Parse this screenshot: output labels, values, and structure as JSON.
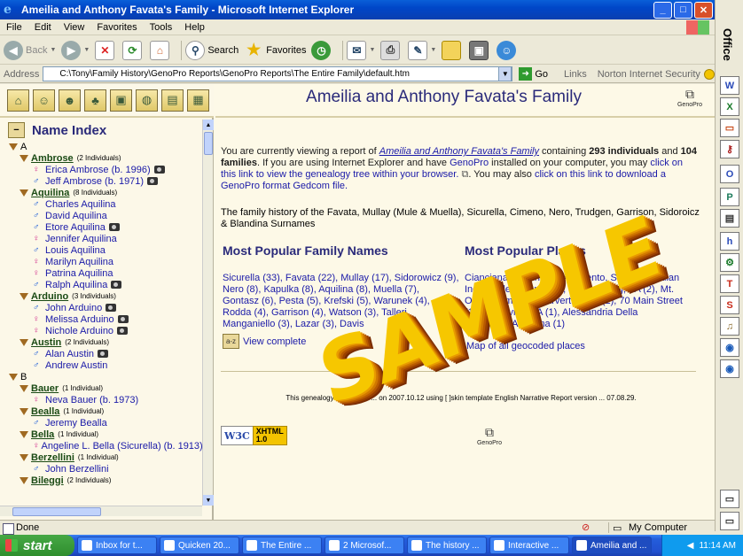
{
  "window": {
    "title": "Ameilia and Anthony Favata's Family - Microsoft Internet Explorer"
  },
  "menu": [
    "File",
    "Edit",
    "View",
    "Favorites",
    "Tools",
    "Help"
  ],
  "toolbar": {
    "back_label": "Back",
    "search_label": "Search",
    "favorites_label": "Favorites"
  },
  "address": {
    "label": "Address",
    "value": "C:\\Tony\\Family History\\GenoPro Reports\\GenoPro Reports\\The Entire Family\\default.htm",
    "go_label": "Go",
    "links_label": "Links",
    "norton_label": "Norton Internet Security"
  },
  "officebar": {
    "title": "Office"
  },
  "left": {
    "index_title": "Name Index",
    "groups": [
      {
        "letter": "A",
        "surnames": [
          {
            "name": "Ambrose",
            "count": "(2 Individuals)",
            "people": [
              {
                "sex": "f",
                "text": "Erica Ambrose (b. 1996)",
                "photo": true
              },
              {
                "sex": "m",
                "text": "Jeff Ambrose (b. 1971)",
                "photo": true
              }
            ]
          },
          {
            "name": "Aquilina",
            "count": "(8 Individuals)",
            "people": [
              {
                "sex": "m",
                "text": "Charles Aquilina",
                "photo": false
              },
              {
                "sex": "m",
                "text": "David Aquilina",
                "photo": false
              },
              {
                "sex": "m",
                "text": "Etore Aquilina",
                "photo": true
              },
              {
                "sex": "f",
                "text": "Jennifer Aquilina",
                "photo": false
              },
              {
                "sex": "m",
                "text": "Louis Aquilina",
                "photo": false
              },
              {
                "sex": "f",
                "text": "Marilyn Aquilina",
                "photo": false
              },
              {
                "sex": "f",
                "text": "Patrina Aquilina",
                "photo": false
              },
              {
                "sex": "m",
                "text": "Ralph Aquilina",
                "photo": true
              }
            ]
          },
          {
            "name": "Arduino",
            "count": "(3 Individuals)",
            "people": [
              {
                "sex": "m",
                "text": "John Arduino",
                "photo": true
              },
              {
                "sex": "f",
                "text": "Melissa Arduino",
                "photo": true
              },
              {
                "sex": "f",
                "text": "Nichole Arduino",
                "photo": true
              }
            ]
          },
          {
            "name": "Austin",
            "count": "(2 Individuals)",
            "people": [
              {
                "sex": "m",
                "text": "Alan Austin",
                "photo": true
              },
              {
                "sex": "m",
                "text": "Andrew Austin",
                "photo": false
              }
            ]
          }
        ]
      },
      {
        "letter": "B",
        "surnames": [
          {
            "name": "Bauer",
            "count": "(1 Individual)",
            "people": [
              {
                "sex": "f",
                "text": "Neva Bauer (b. 1973)",
                "photo": false
              }
            ]
          },
          {
            "name": "Bealla",
            "count": "(1 Individual)",
            "people": [
              {
                "sex": "m",
                "text": "Jeremy Bealla",
                "photo": false
              }
            ]
          },
          {
            "name": "Bella",
            "count": "(1 Individual)",
            "people": [
              {
                "sex": "f",
                "text": "Angeline L. Bella (Sicurella) (b. 1913)",
                "photo": false
              }
            ]
          },
          {
            "name": "Berzellini",
            "count": "(1 Individual)",
            "people": [
              {
                "sex": "m",
                "text": "John Berzellini",
                "photo": false
              }
            ]
          },
          {
            "name": "Bileggi",
            "count": "(2 Individuals)",
            "people": []
          }
        ]
      }
    ]
  },
  "right": {
    "page_title": "Ameilia and Anthony Favata's Family",
    "genopro_label": "GenoPro",
    "intro": {
      "p1": "You are currently viewing a report of",
      "report_link": "Ameilia and Anthony Favata's Family",
      "p2": "containing",
      "individuals": "293 individuals",
      "p3": "and",
      "families": "104 families",
      "p4": ". If you are using Internet Explorer and have",
      "genopro_link": "GenoPro",
      "p5": "installed on your computer, you may",
      "tree_link": "click on this link to view the genealogy tree within your browser.",
      "p6": ". You may also",
      "gedcom_link": "click on this link to download a GenoPro format Gedcom file."
    },
    "history": "The family history of the Favata, Mullay (Mule & Muella), Sicurella, Cimeno, Nero, Trudgen, Garrison, Sidoroicz & Blandina Surnames",
    "popular_names_title": "Most Popular Family Names",
    "popular_places_title": "Most Popular Places",
    "names_lines": [
      "Sicurella (33), Favata (22), Mullay (17), Sidorowicz (9),",
      "Nero (8), Kapulka (8), Aquilina (8), Muella (7),",
      "Gontasz (6), Pesta (5), Krefski (5), Warunek (4),",
      "Rodda (4), Garrison (4), Watson (3), Talleri",
      "Manganiello (3), Lazar (3), Davis"
    ],
    "places_lines": [
      "Cianciana, province of Agrigento, Sicily (3), Italian",
      "Independent Cemetery, W. Wyoming, PA (2), Mt.",
      "Olivet Cemetery, Carverton, PA (2), 70 Main Street",
      "(1), Sykesville, PA (1), Alessandria Della",
      "Rocca (1), Alabama (1)"
    ],
    "az_label": "a-z",
    "view_complete": "View complete",
    "view_map": "Map of all geocoded places",
    "footer": "This genealogy report was ... on 2007.10.12 using [ ]skin template English Narrative Report version ... 07.08.29.",
    "w3c": "W3C",
    "xhtml": "XHTML 1.0"
  },
  "watermark": "SAMPLE",
  "status": {
    "done": "Done",
    "zone": "My Computer"
  },
  "taskbar": {
    "start": "start",
    "tasks": [
      "Inbox for t...",
      "Quicken 20...",
      "The Entire ...",
      "2 Microsof...",
      "The history ...",
      "Interactive ...",
      "Ameilia and ..."
    ],
    "clock": "11:14 AM"
  }
}
